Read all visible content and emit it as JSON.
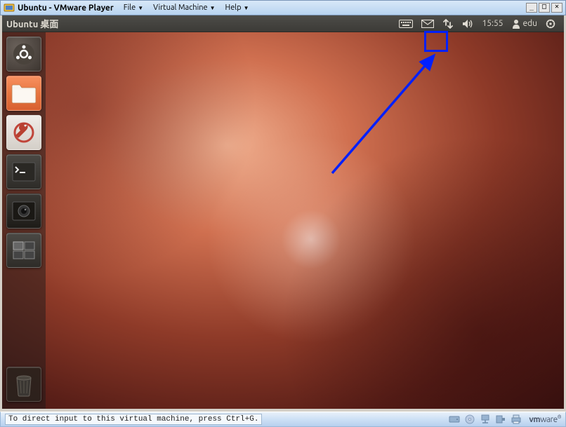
{
  "vmware": {
    "title": "Ubuntu - VMware Player",
    "menu": {
      "file": "File",
      "virtual_machine": "Virtual Machine",
      "help": "Help"
    },
    "status_text": "To direct input to this virtual machine, press Ctrl+G.",
    "brand": "vmware"
  },
  "ubuntu": {
    "panel_title": "Ubuntu 桌面",
    "time": "15:55",
    "user": "edu"
  },
  "launcher": {
    "dash": "dash-home",
    "files": "nautilus-files",
    "settings": "system-settings",
    "terminal": "terminal",
    "camera": "webcam-cheese",
    "workspace": "workspace-switcher",
    "trash": "trash"
  },
  "annotation": {
    "target": "network-indicator",
    "color": "#0020ff"
  }
}
